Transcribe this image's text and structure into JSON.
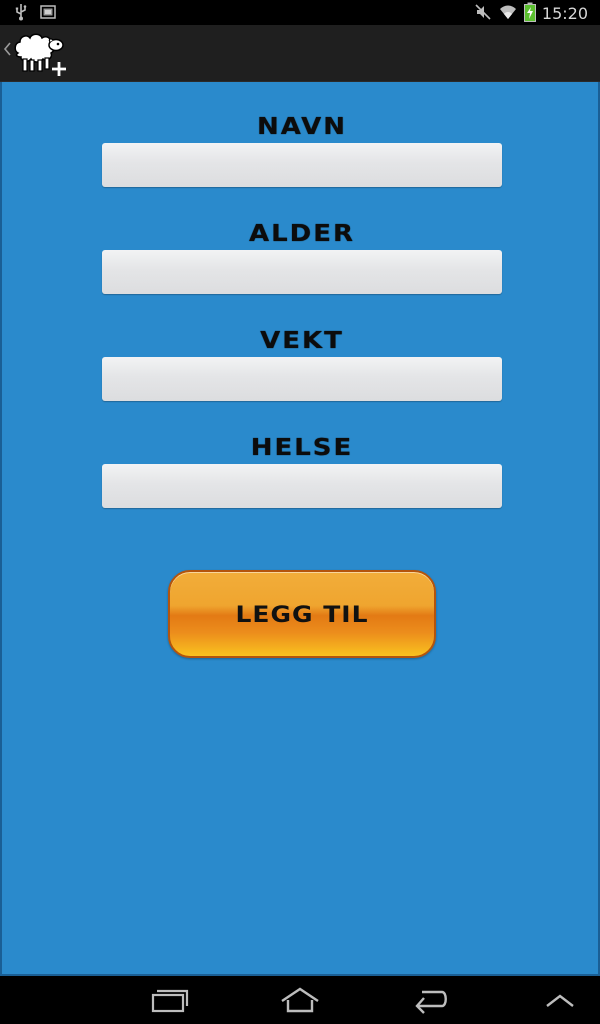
{
  "status_bar": {
    "time": "15:20",
    "left_icons": [
      "usb-icon",
      "sim-icon"
    ],
    "right_icons": [
      "mute-icon",
      "wifi-icon",
      "battery-charging-icon"
    ]
  },
  "action_bar": {
    "back_icon": "chevron-left-icon",
    "logo_icon": "sheep-add-icon"
  },
  "form": {
    "fields": [
      {
        "label": "NAVN",
        "value": "",
        "placeholder": ""
      },
      {
        "label": "ALDER",
        "value": "",
        "placeholder": ""
      },
      {
        "label": "VEKT",
        "value": "",
        "placeholder": ""
      },
      {
        "label": "HELSE",
        "value": "",
        "placeholder": ""
      }
    ],
    "submit_label": "LEGG TIL"
  },
  "nav_bar": {
    "buttons": [
      "recent-apps-icon",
      "home-icon",
      "back-icon",
      "menu-up-icon"
    ]
  },
  "colors": {
    "content_bg": "#2a8acc",
    "button_orange": "#ef9a22",
    "input_bg": "#e4e5e7"
  }
}
